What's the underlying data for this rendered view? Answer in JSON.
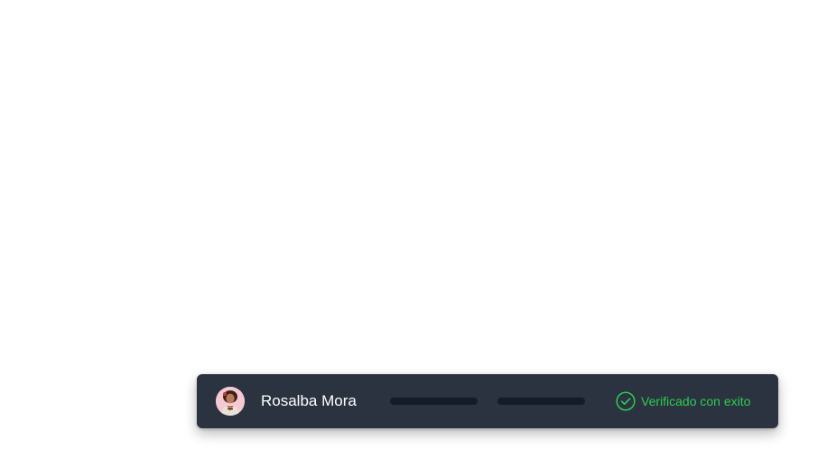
{
  "card": {
    "user_name": "Rosalba Mora",
    "avatar_icon": "user-avatar-photo",
    "status": {
      "text": "Verificado con exito",
      "icon": "check-circle-icon",
      "color": "#2ecc52"
    },
    "background_color": "#2b3340",
    "placeholder_bar_color": "#151c28"
  }
}
